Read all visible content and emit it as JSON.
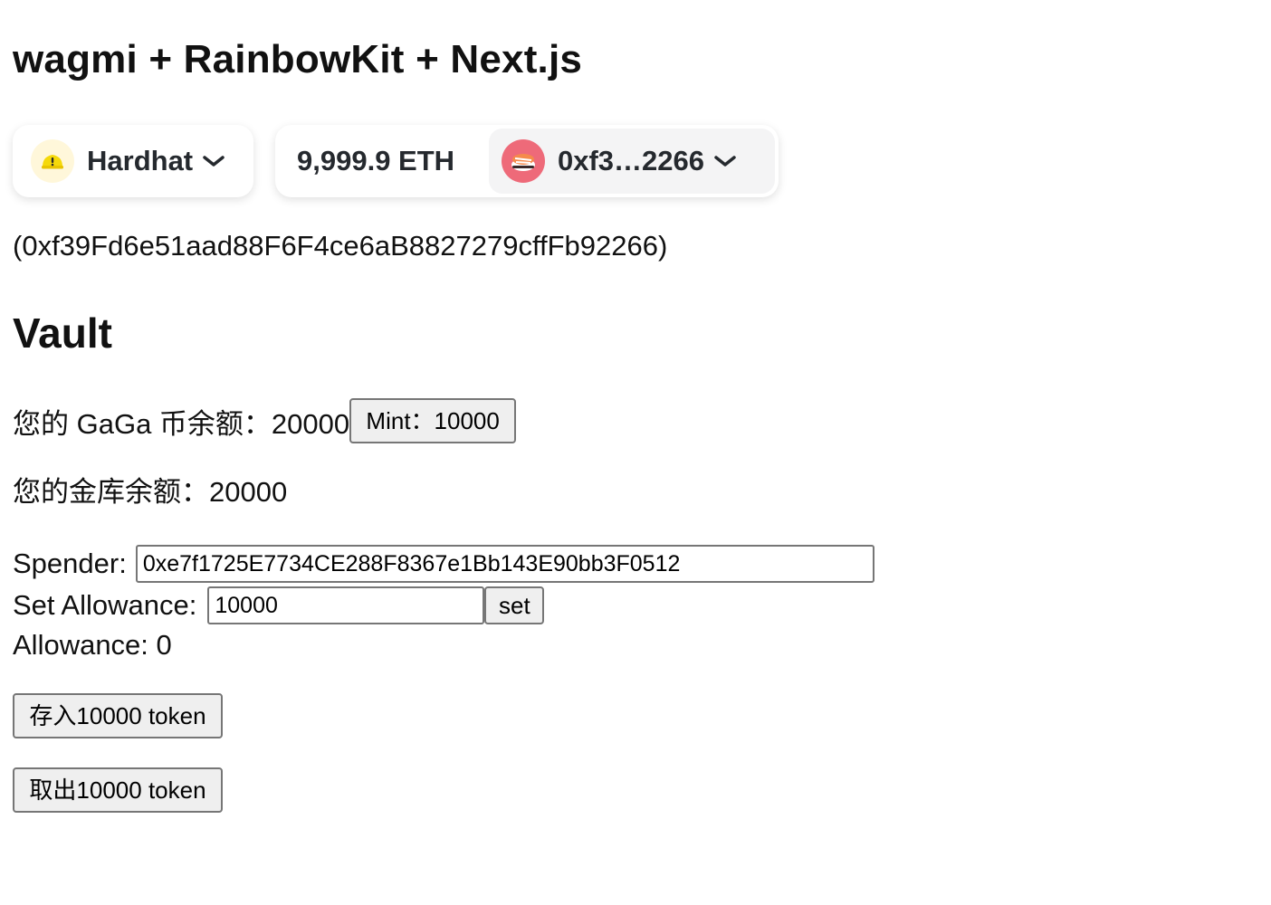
{
  "header": {
    "title": "wagmi + RainbowKit + Next.js"
  },
  "wallet": {
    "chain_name": "Hardhat",
    "chain_icon": "hardhat-icon",
    "balance": "9,999.9 ETH",
    "account_short": "0xf3…2266",
    "avatar_icon": "sushi-emoji-avatar-icon",
    "avatar_bg": "#ee6a79",
    "full_address": "(0xf39Fd6e51aad88F6F4ce6aB8827279cffFb92266)"
  },
  "vault": {
    "title": "Vault",
    "gaga_balance_label": "您的 GaGa 币余额：20000",
    "mint_button": "Mint：10000",
    "vault_balance_label": "您的金库余额：20000",
    "spender_label": "Spender:",
    "spender_value": "0xe7f1725E7734CE288F8367e1Bb143E90bb3F0512",
    "set_allowance_label": "Set Allowance:",
    "allowance_input_value": "10000",
    "set_button": "set",
    "allowance_readout": "Allowance: 0",
    "deposit_button": "存入10000 token",
    "withdraw_button": "取出10000 token"
  }
}
